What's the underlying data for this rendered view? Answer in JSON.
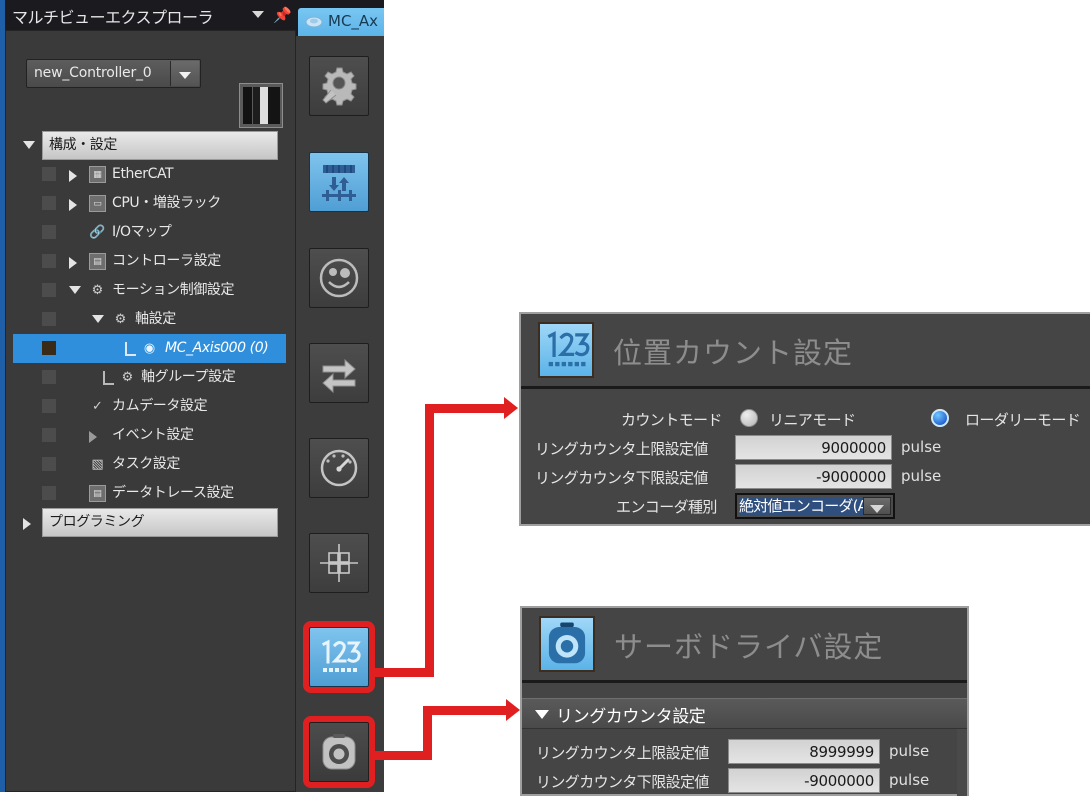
{
  "explorer": {
    "title": "マルチビューエクスプローラ",
    "caret_icon": "chevron-down-icon",
    "pin_icon": "pin-icon",
    "controller": {
      "value": "new_Controller_0",
      "dropdown_icon": "chevron-down-icon"
    },
    "tree": [
      {
        "label": "構成・設定",
        "kind": "header",
        "expander": "down",
        "icon": ""
      },
      {
        "label": "EtherCAT",
        "kind": "item",
        "expander": "right",
        "icon": "ethercat-icon",
        "indent": 1
      },
      {
        "label": "CPU・増設ラック",
        "kind": "item",
        "expander": "right",
        "icon": "rack-icon",
        "indent": 1
      },
      {
        "label": "I/Oマップ",
        "kind": "item",
        "expander": "none",
        "icon": "iomap-icon",
        "indent": 1
      },
      {
        "label": "コントローラ設定",
        "kind": "item",
        "expander": "right",
        "icon": "controller-icon",
        "indent": 1
      },
      {
        "label": "モーション制御設定",
        "kind": "item",
        "expander": "down",
        "icon": "motion-icon",
        "indent": 1
      },
      {
        "label": "軸設定",
        "kind": "item",
        "expander": "down",
        "icon": "axis-icon",
        "indent": 2
      },
      {
        "label": "MC_Axis000 (0)",
        "kind": "selected",
        "expander": "none",
        "icon": "axis-leaf-icon",
        "indent": 3
      },
      {
        "label": "軸グループ設定",
        "kind": "item",
        "expander": "none",
        "icon": "axis-group-icon",
        "indent": 2
      },
      {
        "label": "カムデータ設定",
        "kind": "item",
        "expander": "none",
        "icon": "cam-icon",
        "indent": 1
      },
      {
        "label": "イベント設定",
        "kind": "item",
        "expander": "none",
        "icon": "event-icon",
        "indent": 1
      },
      {
        "label": "タスク設定",
        "kind": "item",
        "expander": "none",
        "icon": "task-icon",
        "indent": 1
      },
      {
        "label": "データトレース設定",
        "kind": "item",
        "expander": "none",
        "icon": "trace-icon",
        "indent": 1
      },
      {
        "label": "プログラミング",
        "kind": "header2",
        "expander": "right",
        "icon": ""
      }
    ]
  },
  "toolstrip": {
    "tab_label": "MC_Ax",
    "tab_icon": "axis-tab-icon",
    "buttons": [
      {
        "name": "axis-basic-settings-button",
        "icon": "gear-wrench-icon",
        "state": "normal"
      },
      {
        "name": "unit-conversion-button",
        "icon": "unit-conversion-icon",
        "state": "active"
      },
      {
        "name": "operation-settings-button",
        "icon": "smiley-gear-icon",
        "state": "normal"
      },
      {
        "name": "io-mapping-button",
        "icon": "two-arrows-icon",
        "state": "normal"
      },
      {
        "name": "limit-settings-button",
        "icon": "gauge-icon",
        "state": "normal"
      },
      {
        "name": "homing-settings-button",
        "icon": "crosshair-grid-icon",
        "state": "normal"
      },
      {
        "name": "position-count-button",
        "icon": "123-counter-icon",
        "state": "highlighted"
      },
      {
        "name": "servo-driver-button",
        "icon": "servo-camera-icon",
        "state": "highlighted"
      }
    ]
  },
  "dialog_position_count": {
    "title": "位置カウント設定",
    "icon": "123-counter-icon",
    "count_mode": {
      "label": "カウントモード",
      "options": [
        {
          "label": "リニアモード",
          "selected": false
        },
        {
          "label": "ローダリーモード",
          "selected": true
        }
      ]
    },
    "fields": [
      {
        "label": "リングカウンタ上限設定値",
        "value": "9000000",
        "unit": "pulse"
      },
      {
        "label": "リングカウンタ下限設定値",
        "value": "-9000000",
        "unit": "pulse"
      }
    ],
    "encoder": {
      "label": "エンコーダ種別",
      "value": "絶対値エンコーダ(ABS)",
      "dropdown_icon": "chevron-down-icon"
    }
  },
  "dialog_servo_driver": {
    "title": "サーボドライバ設定",
    "icon": "servo-camera-icon",
    "section": {
      "label": "リングカウンタ設定",
      "caret_icon": "caret-down-icon"
    },
    "fields": [
      {
        "label": "リングカウンタ上限設定値",
        "value": "8999999",
        "unit": "pulse"
      },
      {
        "label": "リングカウンタ下限設定値",
        "value": "-9000000",
        "unit": "pulse"
      }
    ]
  },
  "annotations": {
    "connector_color": "#e02020",
    "connectors": [
      {
        "name": "connector-position-count",
        "from": "position-count-button",
        "to": "dialog_position_count"
      },
      {
        "name": "connector-servo-driver",
        "from": "servo-driver-button",
        "to": "dialog_servo_driver"
      }
    ]
  }
}
